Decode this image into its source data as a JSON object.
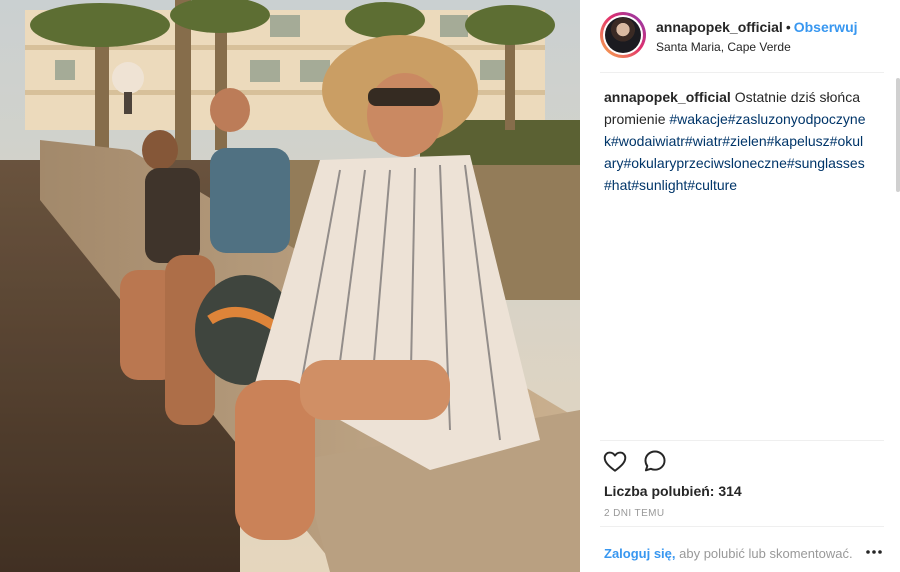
{
  "post": {
    "username": "annapopek_official",
    "dot": "•",
    "follow_label": "Obserwuj",
    "location": "Santa Maria, Cape Verde",
    "caption_text": "Ostatnie dziś słońca promienie",
    "hashtags": "#wakacje#zasluzonyodpoczynek#wodaiwiatr#wiatr#zielen#kapelusz#okulary#okularyprzeciwsloneczne#sunglasses#hat#sunlight#culture",
    "likes": "Liczba polubień: 314",
    "timestamp": "2 DNI TEMU",
    "login_link": "Zaloguj się,",
    "login_rest": " aby polubić lub skomentować.",
    "icons": {
      "avatar": "profile-avatar",
      "like": "heart-icon",
      "comment": "comment-bubble-icon",
      "more": "more-options-icon"
    }
  },
  "colors": {
    "link_blue": "#3897f0",
    "hashtag_blue": "#003569",
    "text": "#262626",
    "muted": "#999999",
    "divider": "#efefef"
  }
}
